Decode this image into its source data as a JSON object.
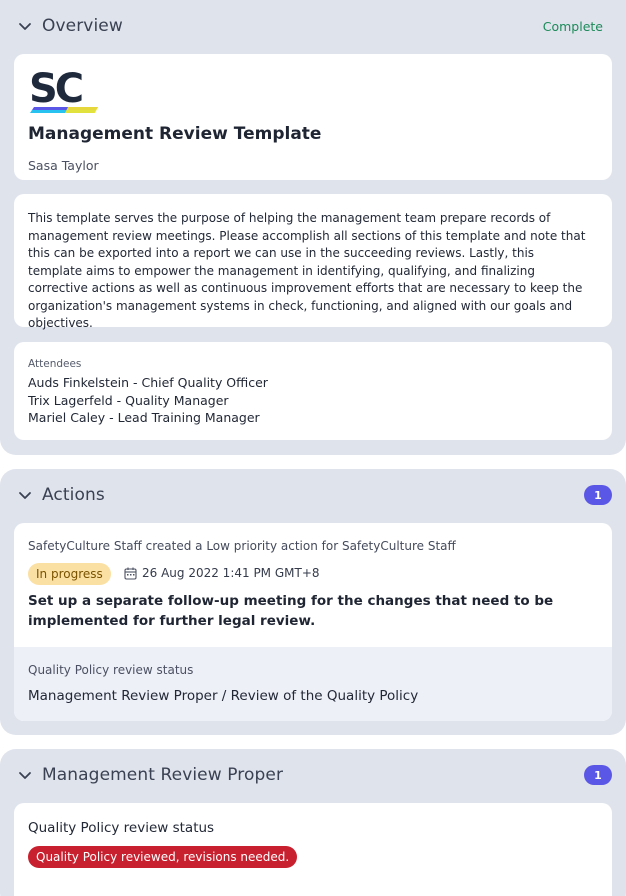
{
  "overview": {
    "title": "Overview",
    "status": "Complete",
    "status_color": "#1c8a5a",
    "logo_text": "SC",
    "template_title": "Management Review Template",
    "author": "Sasa Taylor",
    "description": "This template serves the purpose of helping the management team prepare records of management review meetings. Please accomplish all sections of this template and note that this can be exported into a report we can use in the succeeding reviews. Lastly, this template aims to empower the management in identifying, qualifying, and finalizing corrective actions as well as continuous improvement efforts that are necessary to keep the organization's management systems in check, functioning, and aligned with our goals and objectives.",
    "attendees_label": "Attendees",
    "attendees": [
      "Auds Finkelstein - Chief Quality Officer",
      "Trix Lagerfeld - Quality Manager",
      "Mariel Caley - Lead Training Manager"
    ]
  },
  "actions": {
    "title": "Actions",
    "count": "1",
    "item": {
      "meta": "SafetyCulture Staff created a Low priority action for SafetyCulture Staff",
      "status": "In progress",
      "date_icon": "calendar-icon",
      "date": "26 Aug 2022 1:41 PM GMT+8",
      "title": "Set up a separate follow-up meeting for the changes that need to be implemented for further legal review.",
      "question_label": "Quality Policy review status",
      "path": "Management Review Proper / Review of the Quality Policy"
    }
  },
  "mrp": {
    "title": "Management Review Proper",
    "count": "1",
    "question": "Quality Policy review status",
    "answer": "Quality Policy reviewed, revisions needed.",
    "answer_color": "#c8202e"
  },
  "icons": {
    "collapse": "chevron-down-icon",
    "calendar": "calendar-icon"
  },
  "colors": {
    "section_bg": "#dfe3ec",
    "badge": "#5b57e6",
    "in_progress_bg": "#fbe0a3"
  }
}
